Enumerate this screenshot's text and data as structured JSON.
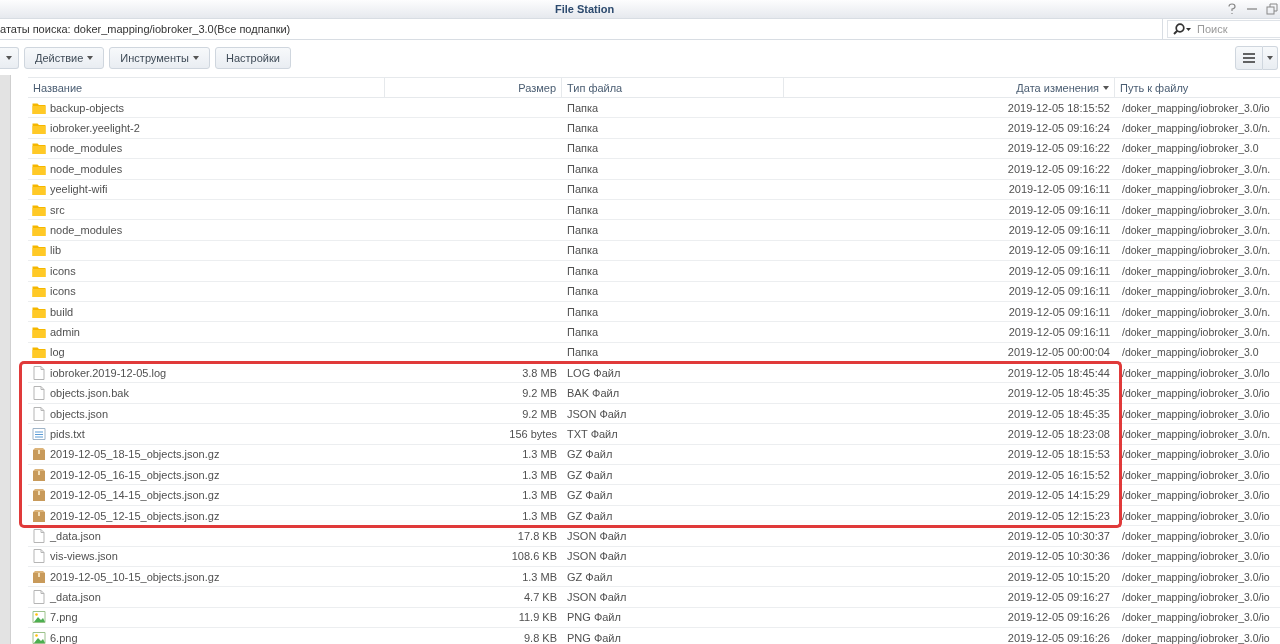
{
  "window": {
    "title": "File Station"
  },
  "location_bar": {
    "text": "ататы поиска: doker_mapping/iobroker_3.0(Все подпапки)"
  },
  "search": {
    "placeholder": "Поиск"
  },
  "toolbar": {
    "buttons": [
      {
        "label": "Действие",
        "dropdown": true
      },
      {
        "label": "Инструменты",
        "dropdown": true
      },
      {
        "label": "Настройки",
        "dropdown": false
      }
    ]
  },
  "table": {
    "columns": [
      {
        "label": "Название",
        "sorted": false
      },
      {
        "label": "Размер",
        "sorted": false
      },
      {
        "label": "Тип файла",
        "sorted": false
      },
      {
        "label": "Дата изменения",
        "sorted": true
      },
      {
        "label": "Путь к файлу",
        "sorted": false
      }
    ],
    "rows": [
      {
        "kind": "folder",
        "name": "backup-objects",
        "type": "Папка",
        "modified": "2019-12-05 18:15:52",
        "path": "/doker_mapping/iobroker_3.0/io",
        "highlighted": false
      },
      {
        "kind": "folder",
        "name": "iobroker.yeelight-2",
        "type": "Папка",
        "modified": "2019-12-05 09:16:24",
        "path": "/doker_mapping/iobroker_3.0/n.",
        "highlighted": false
      },
      {
        "kind": "folder",
        "name": "node_modules",
        "type": "Папка",
        "modified": "2019-12-05 09:16:22",
        "path": "/doker_mapping/iobroker_3.0",
        "highlighted": false
      },
      {
        "kind": "folder",
        "name": "node_modules",
        "type": "Папка",
        "modified": "2019-12-05 09:16:22",
        "path": "/doker_mapping/iobroker_3.0/n.",
        "highlighted": false
      },
      {
        "kind": "folder",
        "name": "yeelight-wifi",
        "type": "Папка",
        "modified": "2019-12-05 09:16:11",
        "path": "/doker_mapping/iobroker_3.0/n.",
        "highlighted": false
      },
      {
        "kind": "folder",
        "name": "src",
        "type": "Папка",
        "modified": "2019-12-05 09:16:11",
        "path": "/doker_mapping/iobroker_3.0/n.",
        "highlighted": false
      },
      {
        "kind": "folder",
        "name": "node_modules",
        "type": "Папка",
        "modified": "2019-12-05 09:16:11",
        "path": "/doker_mapping/iobroker_3.0/n.",
        "highlighted": false
      },
      {
        "kind": "folder",
        "name": "lib",
        "type": "Папка",
        "modified": "2019-12-05 09:16:11",
        "path": "/doker_mapping/iobroker_3.0/n.",
        "highlighted": false
      },
      {
        "kind": "folder",
        "name": "icons",
        "type": "Папка",
        "modified": "2019-12-05 09:16:11",
        "path": "/doker_mapping/iobroker_3.0/n.",
        "highlighted": false
      },
      {
        "kind": "folder",
        "name": "icons",
        "type": "Папка",
        "modified": "2019-12-05 09:16:11",
        "path": "/doker_mapping/iobroker_3.0/n.",
        "highlighted": false
      },
      {
        "kind": "folder",
        "name": "build",
        "type": "Папка",
        "modified": "2019-12-05 09:16:11",
        "path": "/doker_mapping/iobroker_3.0/n.",
        "highlighted": false
      },
      {
        "kind": "folder",
        "name": "admin",
        "type": "Папка",
        "modified": "2019-12-05 09:16:11",
        "path": "/doker_mapping/iobroker_3.0/n.",
        "highlighted": false
      },
      {
        "kind": "folder",
        "name": "log",
        "type": "Папка",
        "modified": "2019-12-05 00:00:04",
        "path": "/doker_mapping/iobroker_3.0",
        "highlighted": false
      },
      {
        "kind": "file",
        "name": "iobroker.2019-12-05.log",
        "size": "3.8 MB",
        "type": "LOG Файл",
        "modified": "2019-12-05 18:45:44",
        "path": "/doker_mapping/iobroker_3.0/lo",
        "highlighted": true
      },
      {
        "kind": "file",
        "name": "objects.json.bak",
        "size": "9.2 MB",
        "type": "BAK Файл",
        "modified": "2019-12-05 18:45:35",
        "path": "/doker_mapping/iobroker_3.0/io",
        "highlighted": true
      },
      {
        "kind": "file",
        "name": "objects.json",
        "size": "9.2 MB",
        "type": "JSON Файл",
        "modified": "2019-12-05 18:45:35",
        "path": "/doker_mapping/iobroker_3.0/io",
        "highlighted": true
      },
      {
        "kind": "text",
        "name": "pids.txt",
        "size": "156 bytes",
        "type": "TXT Файл",
        "modified": "2019-12-05 18:23:08",
        "path": "/doker_mapping/iobroker_3.0/n.",
        "highlighted": true
      },
      {
        "kind": "archive",
        "name": "2019-12-05_18-15_objects.json.gz",
        "size": "1.3 MB",
        "type": "GZ Файл",
        "modified": "2019-12-05 18:15:53",
        "path": "/doker_mapping/iobroker_3.0/io",
        "highlighted": true
      },
      {
        "kind": "archive",
        "name": "2019-12-05_16-15_objects.json.gz",
        "size": "1.3 MB",
        "type": "GZ Файл",
        "modified": "2019-12-05 16:15:52",
        "path": "/doker_mapping/iobroker_3.0/io",
        "highlighted": true
      },
      {
        "kind": "archive",
        "name": "2019-12-05_14-15_objects.json.gz",
        "size": "1.3 MB",
        "type": "GZ Файл",
        "modified": "2019-12-05 14:15:29",
        "path": "/doker_mapping/iobroker_3.0/io",
        "highlighted": true
      },
      {
        "kind": "archive",
        "name": "2019-12-05_12-15_objects.json.gz",
        "size": "1.3 MB",
        "type": "GZ Файл",
        "modified": "2019-12-05 12:15:23",
        "path": "/doker_mapping/iobroker_3.0/io",
        "highlighted": true
      },
      {
        "kind": "file",
        "name": "_data.json",
        "size": "17.8 KB",
        "type": "JSON Файл",
        "modified": "2019-12-05 10:30:37",
        "path": "/doker_mapping/iobroker_3.0/io",
        "highlighted": false
      },
      {
        "kind": "file",
        "name": "vis-views.json",
        "size": "108.6 KB",
        "type": "JSON Файл",
        "modified": "2019-12-05 10:30:36",
        "path": "/doker_mapping/iobroker_3.0/io",
        "highlighted": false
      },
      {
        "kind": "archive",
        "name": "2019-12-05_10-15_objects.json.gz",
        "size": "1.3 MB",
        "type": "GZ Файл",
        "modified": "2019-12-05 10:15:20",
        "path": "/doker_mapping/iobroker_3.0/io",
        "highlighted": false
      },
      {
        "kind": "file",
        "name": "_data.json",
        "size": "4.7 KB",
        "type": "JSON Файл",
        "modified": "2019-12-05 09:16:27",
        "path": "/doker_mapping/iobroker_3.0/io",
        "highlighted": false
      },
      {
        "kind": "image",
        "name": "7.png",
        "size": "11.9 KB",
        "type": "PNG Файл",
        "modified": "2019-12-05 09:16:26",
        "path": "/doker_mapping/iobroker_3.0/io",
        "highlighted": false
      },
      {
        "kind": "image",
        "name": "6.png",
        "size": "9.8 KB",
        "type": "PNG Файл",
        "modified": "2019-12-05 09:16:26",
        "path": "/doker_mapping/iobroker_3.0/io",
        "highlighted": false
      }
    ]
  }
}
